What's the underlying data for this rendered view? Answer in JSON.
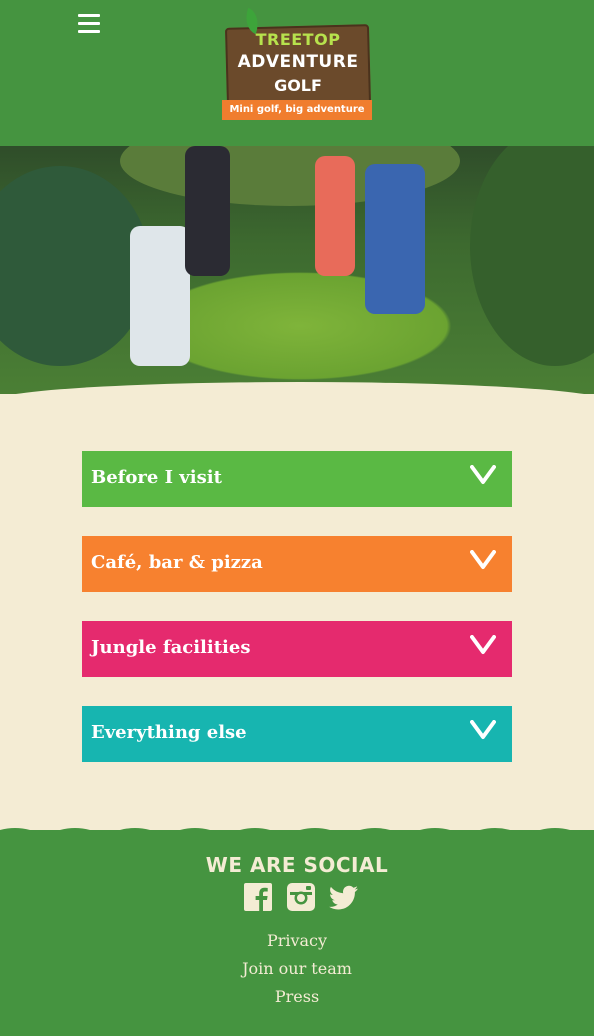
{
  "header": {
    "menu_icon": "hamburger-menu-icon",
    "logo": {
      "line1": "TREETOP",
      "line2": "ADVENTURE",
      "line3": "GOLF",
      "tagline": "Mini golf, big adventure"
    }
  },
  "hero": {
    "image": "photo of people playing indoor jungle mini golf"
  },
  "accordions": [
    {
      "label": "Before I visit",
      "color": "#5ab944"
    },
    {
      "label": "Café, bar & pizza",
      "color": "#f7812f"
    },
    {
      "label": "Jungle facilities",
      "color": "#e52a6e"
    },
    {
      "label": "Everything else",
      "color": "#17b5b0"
    }
  ],
  "footer": {
    "social_title": "WE ARE SOCIAL",
    "social_icons": [
      "facebook-icon",
      "instagram-icon",
      "twitter-icon"
    ],
    "links": [
      "Privacy",
      "Join our team",
      "Press"
    ]
  },
  "colors": {
    "header_bg": "#459440",
    "page_bg": "#f4ecd4",
    "footer_text": "#f4ecd4"
  }
}
